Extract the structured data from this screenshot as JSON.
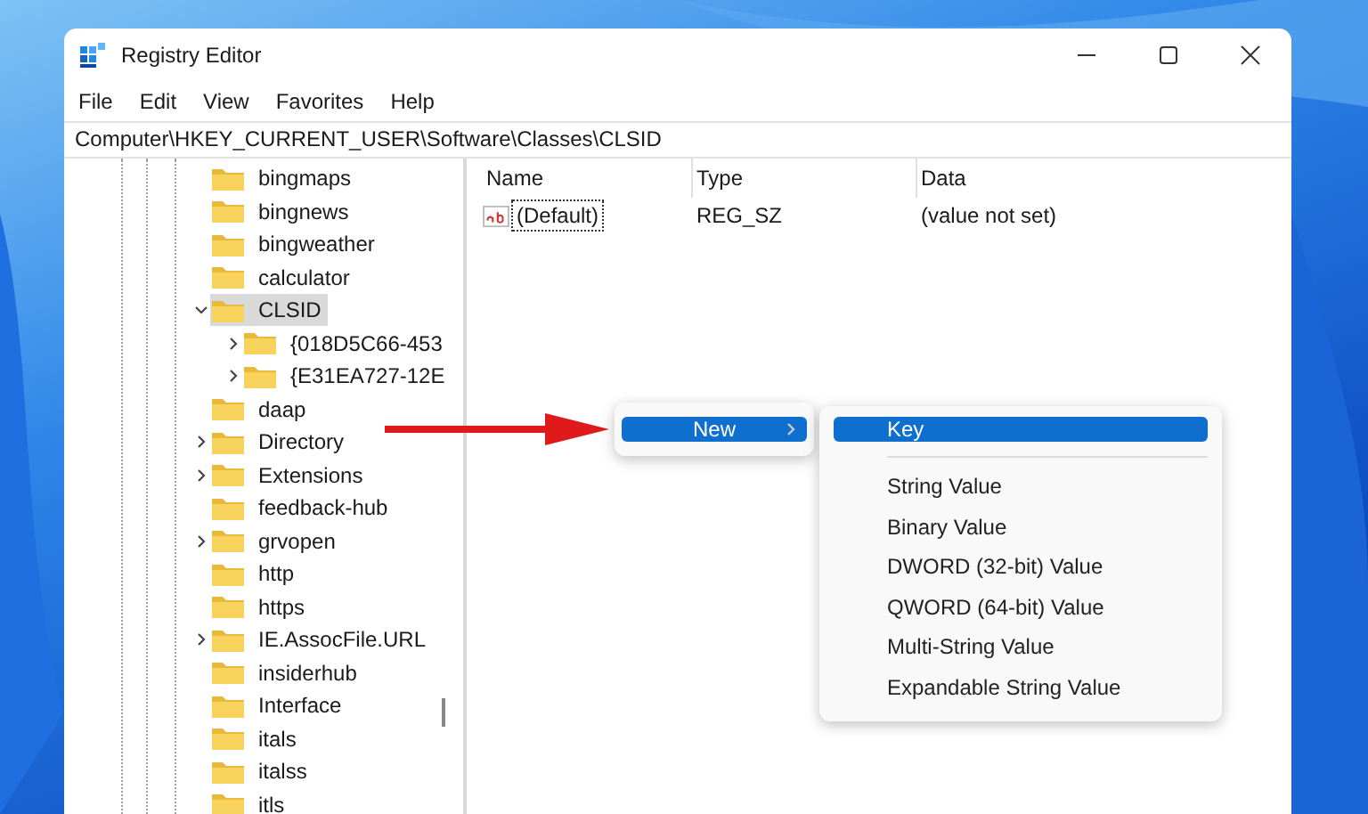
{
  "window": {
    "title": "Registry Editor"
  },
  "menu_bar": [
    "File",
    "Edit",
    "View",
    "Favorites",
    "Help"
  ],
  "address_bar": {
    "value": "Computer\\HKEY_CURRENT_USER\\Software\\Classes\\CLSID"
  },
  "tree": [
    {
      "label": "bingmaps",
      "expandable": false,
      "expanded": false,
      "selected": false
    },
    {
      "label": "bingnews",
      "expandable": false,
      "expanded": false,
      "selected": false
    },
    {
      "label": "bingweather",
      "expandable": false,
      "expanded": false,
      "selected": false
    },
    {
      "label": "calculator",
      "expandable": false,
      "expanded": false,
      "selected": false
    },
    {
      "label": "CLSID",
      "expandable": true,
      "expanded": true,
      "selected": true,
      "children": [
        {
          "label": "{018D5C66-453",
          "expandable": true,
          "expanded": false,
          "selected": false
        },
        {
          "label": "{E31EA727-12E",
          "expandable": true,
          "expanded": false,
          "selected": false
        }
      ]
    },
    {
      "label": "daap",
      "expandable": false,
      "expanded": false,
      "selected": false
    },
    {
      "label": "Directory",
      "expandable": true,
      "expanded": false,
      "selected": false
    },
    {
      "label": "Extensions",
      "expandable": true,
      "expanded": false,
      "selected": false
    },
    {
      "label": "feedback-hub",
      "expandable": false,
      "expanded": false,
      "selected": false
    },
    {
      "label": "grvopen",
      "expandable": true,
      "expanded": false,
      "selected": false
    },
    {
      "label": "http",
      "expandable": false,
      "expanded": false,
      "selected": false
    },
    {
      "label": "https",
      "expandable": false,
      "expanded": false,
      "selected": false
    },
    {
      "label": "IE.AssocFile.URL",
      "expandable": true,
      "expanded": false,
      "selected": false
    },
    {
      "label": "insiderhub",
      "expandable": false,
      "expanded": false,
      "selected": false
    },
    {
      "label": "Interface",
      "expandable": false,
      "expanded": false,
      "selected": false
    },
    {
      "label": "itals",
      "expandable": false,
      "expanded": false,
      "selected": false
    },
    {
      "label": "italss",
      "expandable": false,
      "expanded": false,
      "selected": false
    },
    {
      "label": "itls",
      "expandable": false,
      "expanded": false,
      "selected": false
    }
  ],
  "values_table": {
    "columns": [
      "Name",
      "Type",
      "Data"
    ],
    "rows": [
      {
        "name": "(Default)",
        "type": "REG_SZ",
        "data": "(value not set)",
        "focused": true
      }
    ]
  },
  "context_menu": {
    "items": [
      {
        "label": "New",
        "selected": true,
        "has_submenu": true
      }
    ]
  },
  "submenu": {
    "items": [
      {
        "kind": "item",
        "label": "Key",
        "selected": true
      },
      {
        "kind": "separator"
      },
      {
        "kind": "item",
        "label": "String Value",
        "selected": false
      },
      {
        "kind": "item",
        "label": "Binary Value",
        "selected": false
      },
      {
        "kind": "item",
        "label": "DWORD (32-bit) Value",
        "selected": false
      },
      {
        "kind": "item",
        "label": "QWORD (64-bit) Value",
        "selected": false
      },
      {
        "kind": "item",
        "label": "Multi-String Value",
        "selected": false
      },
      {
        "kind": "item",
        "label": "Expandable String Value",
        "selected": false
      }
    ]
  }
}
